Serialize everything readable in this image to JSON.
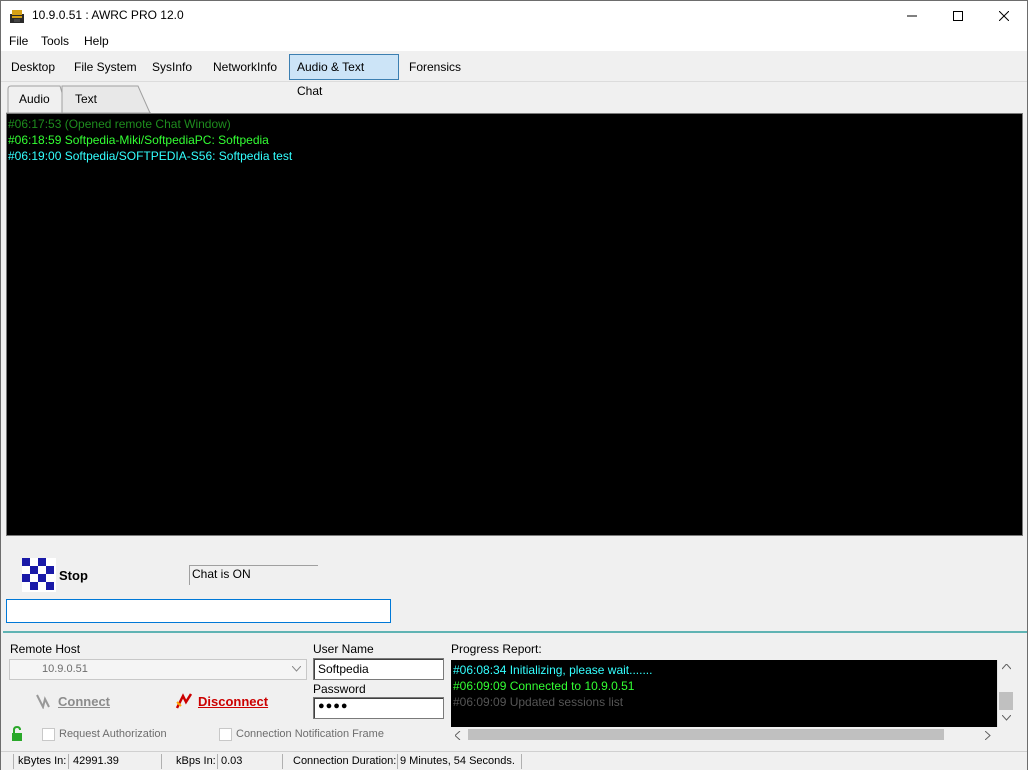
{
  "window": {
    "title": "10.9.0.51 : AWRC PRO 12.0"
  },
  "menu": [
    "File",
    "Tools",
    "Help"
  ],
  "main_tabs": [
    "Desktop",
    "File System",
    "SysInfo",
    "NetworkInfo",
    "Audio & Text Chat",
    "Forensics"
  ],
  "sub_tabs": [
    "Audio",
    "Text Chat"
  ],
  "chat": {
    "lines": [
      {
        "text": "#06:17:53 (Opened remote Chat Window)",
        "color": "#1e8c1e"
      },
      {
        "text": "#06:18:59 Softpedia-Miki/SoftpediaPC: Softpedia",
        "color": "#33ff33"
      },
      {
        "text": "#06:19:00 Softpedia/SOFTPEDIA-S56: Softpedia test",
        "color": "#33ffff"
      }
    ],
    "stop_label": "Stop",
    "status": "Chat is ON",
    "input_value": ""
  },
  "connection": {
    "remote_host_label": "Remote Host",
    "remote_host_value": "10.9.0.51",
    "user_name_label": "User Name",
    "user_name_value": "Softpedia",
    "password_label": "Password",
    "password_value": "●●●●",
    "connect_label": "Connect",
    "disconnect_label": "Disconnect",
    "request_auth_label": "Request Authorization",
    "conn_notification_label": "Connection Notification Frame"
  },
  "progress": {
    "label": "Progress Report:",
    "lines": [
      {
        "text": "#06:08:34 Initializing, please wait.......",
        "color": "#33ffff"
      },
      {
        "text": "#06:09:09 Connected to 10.9.0.51",
        "color": "#33ff33"
      },
      {
        "text": "#06:09:09 Updated sessions list",
        "color": "#555555"
      }
    ]
  },
  "statusbar": {
    "kbytes_in_label": "kBytes In:",
    "kbytes_in_value": "42991.39",
    "kbps_in_label": "kBps In:",
    "kbps_in_value": "0.03",
    "duration_label": "Connection Duration:",
    "duration_value": "9 Minutes, 54 Seconds."
  },
  "colors": {
    "accent": "#0078d7",
    "tab_active": "#cce4f7",
    "disconnect": "#cc0000",
    "divider": "#5fb3b3"
  }
}
